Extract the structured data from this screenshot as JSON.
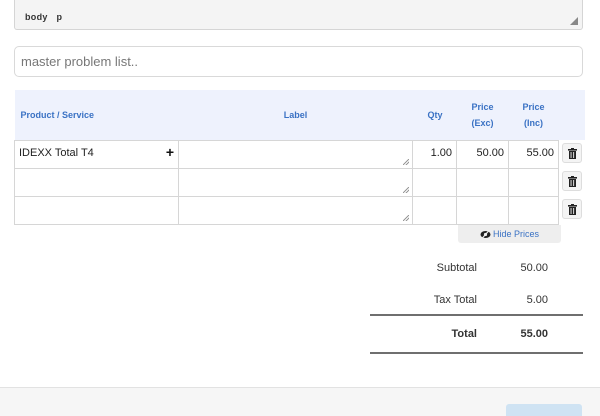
{
  "editor": {
    "path": [
      "body",
      "p"
    ]
  },
  "problem_list": {
    "placeholder": "master problem list.."
  },
  "table": {
    "headers": {
      "product": "Product / Service",
      "label": "Label",
      "qty": "Qty",
      "price_exc_line1": "Price",
      "price_exc_line2": "(Exc)",
      "price_inc_line1": "Price",
      "price_inc_line2": "(Inc)"
    },
    "rows": [
      {
        "product": "IDEXX Total T4",
        "label": "",
        "qty": "1.00",
        "price_exc": "50.00",
        "price_inc": "55.00"
      },
      {
        "product": "",
        "label": "",
        "qty": "",
        "price_exc": "",
        "price_inc": ""
      },
      {
        "product": "",
        "label": "",
        "qty": "",
        "price_exc": "",
        "price_inc": ""
      }
    ],
    "add_icon": "plus-icon",
    "delete_icon": "trash-icon"
  },
  "hide_prices": {
    "label": "Hide Prices",
    "icon": "eye-slash-icon"
  },
  "totals": {
    "subtotal_label": "Subtotal",
    "subtotal_value": "50.00",
    "tax_label": "Tax Total",
    "tax_value": "5.00",
    "total_label": "Total",
    "total_value": "55.00"
  },
  "colors": {
    "accent": "#3a72c4",
    "header_bg": "#eef2fd"
  }
}
